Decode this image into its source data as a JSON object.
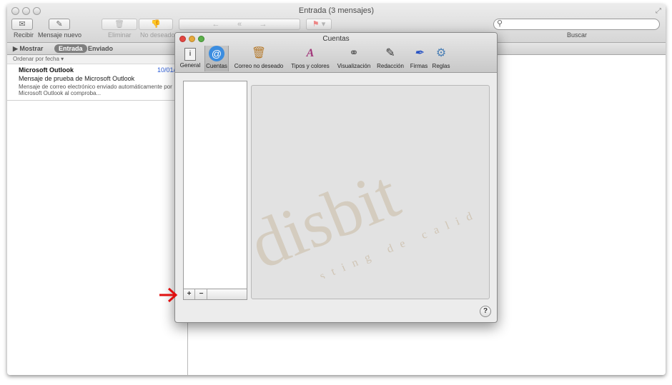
{
  "window": {
    "title": "Entrada (3 mensajes)"
  },
  "toolbar": {
    "receive": "Recibir",
    "new_message": "Mensaje nuevo",
    "delete": "Eliminar",
    "junk": "No deseado",
    "search_label": "Buscar"
  },
  "favorites": {
    "show": "Mostrar",
    "inbox": "Entrada",
    "sent": "Enviado"
  },
  "sort_label": "Ordenar por fecha",
  "messages": [
    {
      "from": "Microsoft Outlook",
      "date": "10/01/",
      "subject": "Mensaje de prueba de Microsoft Outlook",
      "preview": "Mensaje de correo electrónico enviado automáticamente por Microsoft Outlook al comproba..."
    }
  ],
  "dialog": {
    "title": "Cuentas",
    "prefs": [
      {
        "label": "General",
        "icon": "general-icon"
      },
      {
        "label": "Cuentas",
        "icon": "at-icon"
      },
      {
        "label": "Correo no deseado",
        "icon": "junk-mail-icon"
      },
      {
        "label": "Tipos y colores",
        "icon": "fonts-colors-icon"
      },
      {
        "label": "Visualización",
        "icon": "viewing-icon"
      },
      {
        "label": "Redacción",
        "icon": "composing-icon"
      },
      {
        "label": "Firmas",
        "icon": "signatures-icon"
      },
      {
        "label": "Reglas",
        "icon": "rules-icon"
      }
    ],
    "add": "+",
    "remove": "−",
    "help": "?"
  },
  "watermark": {
    "brand": "disbit",
    "tagline": "Hosting de calidad"
  },
  "colors": {
    "close": "#e2463f",
    "minimize": "#e6a93b",
    "zoom": "#5cb04a",
    "arrow": "#e01010",
    "link": "#2a5bd7"
  }
}
